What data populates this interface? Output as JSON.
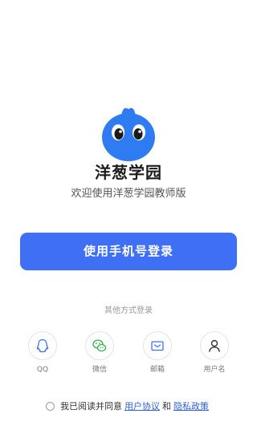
{
  "app": {
    "name": "洋葱学园",
    "welcome": "欢迎使用洋葱学园教师版"
  },
  "login": {
    "phone_button": "使用手机号登录"
  },
  "other_login": {
    "title": "其他方式登录",
    "methods": [
      {
        "label": "QQ",
        "icon": "qq-icon"
      },
      {
        "label": "微信",
        "icon": "wechat-icon"
      },
      {
        "label": "邮箱",
        "icon": "mail-icon"
      },
      {
        "label": "用户名",
        "icon": "user-icon"
      }
    ]
  },
  "agreement": {
    "prefix": "我已阅读并同意",
    "user_agreement": "用户协议",
    "and": "和",
    "privacy_policy": "隐私政策"
  },
  "colors": {
    "primary": "#3f6ff5",
    "mascot": "#2f7cf2",
    "link": "#2f5fd8"
  }
}
